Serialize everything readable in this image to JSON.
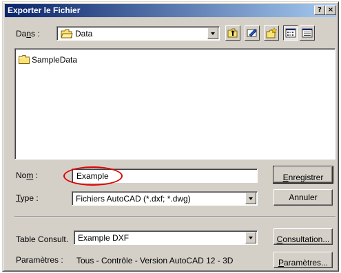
{
  "dialog": {
    "title": "Exporter le Fichier",
    "help_label": "?",
    "close_label": "×"
  },
  "lookin": {
    "label_prefix": "Da",
    "label_underlined": "n",
    "label_suffix": "s :",
    "value": "Data"
  },
  "toolbar": {
    "buttons": [
      {
        "name": "up-folder-icon"
      },
      {
        "name": "desktop-icon"
      },
      {
        "name": "new-folder-icon"
      },
      {
        "name": "list-view-icon",
        "pressed": true
      },
      {
        "name": "details-view-icon"
      }
    ]
  },
  "file_list": {
    "items": [
      {
        "label": "SampleData",
        "icon": "folder-icon"
      }
    ]
  },
  "name_field": {
    "label_prefix": "No",
    "label_underlined": "m",
    "label_suffix": " :",
    "value": "Example"
  },
  "type_field": {
    "label_underlined": "T",
    "label_suffix": "ype :",
    "value": "Fichiers AutoCAD (*.dxf; *.dwg)"
  },
  "buttons": {
    "save_underlined": "E",
    "save_suffix": "nregistrer",
    "cancel": "Annuler",
    "consult_underlined": "C",
    "consult_suffix": "onsultation...",
    "params_underlined": "P",
    "params_suffix": "aramètres..."
  },
  "table_consult": {
    "label": "Table Consult.",
    "value": "Example DXF"
  },
  "parameters": {
    "label": "Paramètres :",
    "value": "Tous - Contrôle - Version AutoCAD 12 - 3D"
  },
  "colors": {
    "title_gradient_start": "#0a246a",
    "title_gradient_end": "#a6caf0",
    "face": "#d4d0c8",
    "highlight_ellipse": "#e00000"
  }
}
